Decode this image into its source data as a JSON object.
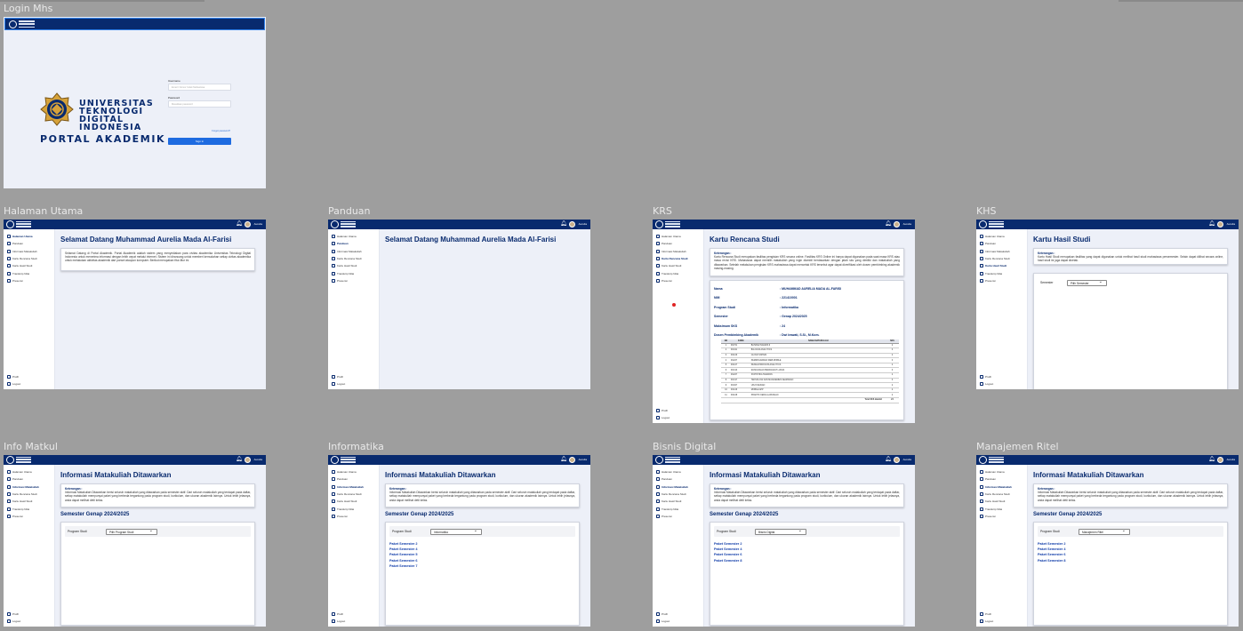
{
  "frames": {
    "login": "Login Mhs",
    "halaman_utama": "Halaman Utama",
    "panduan": "Panduan",
    "krs": "KRS",
    "khs": "KHS",
    "info_matkul": "Info Matkul",
    "informatika": "Informatika",
    "bisnis_digital": "Bisnis Digital",
    "manajemen_ritel": "Manajemen Ritel"
  },
  "colors": {
    "navy": "#082a6e",
    "accent_blue": "#1e6be0",
    "canvas": "#9e9e9e",
    "page_bg": "#edf0f8"
  },
  "login": {
    "uni_lines": [
      "UNIVERSITAS",
      "TEKNOLOGI",
      "DIGITAL",
      "INDONESIA"
    ],
    "portal": "PORTAL AKADEMIK",
    "username_label": "Username",
    "username_placeholder": "Email / Nomor Induk Mahasiswa",
    "password_label": "Password",
    "password_placeholder": "Masukkan password",
    "forgot": "Forgot password?",
    "signin": "Sign in"
  },
  "topbar": {
    "user": "Aurelia",
    "bell_icon": "bell-icon"
  },
  "nav": {
    "items": [
      "Halaman Utama",
      "Panduan",
      "Informasi Matakuliah",
      "Kartu Rencana Studi",
      "Kartu Hasil Studi",
      "Transkrip Nilai",
      "Presensi"
    ],
    "profil": "Profil",
    "logout": "Logout"
  },
  "home": {
    "welcome": "Selamat Datang Muhammad Aurelia Mada Al-Farisi",
    "text": "Selamat Datang di Portal Akademik. Portal Akademik adalah sistem yang menyediakan para civitas akademika Universitas Teknologi Digital Indonesia untuk menerima informasi dengan lebih cepat melalui internet. Sistem ini dirancang untuk memberi kemudahan setiap civitas akademika untuk melakukan aktivitas akademik dari ponsel ataupun komputer. Berikut merupakan fitur-fitur ini."
  },
  "krs": {
    "title": "Kartu Rencana Studi",
    "ket_title": "Keterangan :",
    "ket_text": "Kartu Rencana Studi merupakan fasilitas pengisian KRS secara online. Fasilitas KRS Online ini hanya dapat digunakan pada saat masa KRS atau masa revisi KRS. Mahasiswa dapat memilih matakuliah yang ingin diambil berdasarkan dengan jatah sks yang dimiliki dan matakuliah yang ditawarkan. Setelah melakukan pengisian KRS mahasiswa dapat mencetak KRS tersebut agar dapat diverifikasi oleh dosen pembimbing akademik masing-masing.",
    "labels": [
      "Nama",
      "NIM",
      "Program Studi",
      "Semester",
      "Maksimum SKS",
      "Dosen Pembimbing Akademik"
    ],
    "values": [
      ": MUHAMMAD AURELIA MADA AL-FARISI",
      ": 221410001",
      ": Informatika",
      ": Genap 2024/2025",
      ": 24",
      ": Dwi Irawati, S.Si., M.Kom."
    ],
    "table_head": [
      "NO",
      "KODE",
      "NAMA MATAKULIAH",
      "SKS"
    ],
    "rows": [
      [
        "1",
        "IF4701",
        "BAHASA INGGRIS II",
        "2"
      ],
      [
        "2",
        "IF4321",
        "BIG DATA ANALYTICS",
        "3"
      ],
      [
        "3",
        "IF4106",
        "CLOUD SISTEM",
        "2"
      ],
      [
        "4",
        "IF4207",
        "PEMROGRAMAN WEB MOBILE",
        "3"
      ],
      [
        "5",
        "IF4107",
        "PENGANTAR DATA ANALYTICS",
        "2"
      ],
      [
        "6",
        "IF4313",
        "RANCANGAN PERANGKAT LUNAK",
        "3"
      ],
      [
        "7",
        "IF4207",
        "STATISTIKA TERAPAN",
        "2"
      ],
      [
        "8",
        "IF4317",
        "TEKNOLOGI DAN MANAJEMEN KEAMANAN",
        "3"
      ],
      [
        "9",
        "IF4307",
        "UI/UX DESIGN",
        "2"
      ],
      [
        "10",
        "IF4106",
        "MOBILE APP",
        "2"
      ],
      [
        "11",
        "IF4108",
        "PRAKTIK KERJA LAPANGAN",
        "2"
      ]
    ],
    "total_label": "Total SKS diambil",
    "total": "24"
  },
  "khs": {
    "title": "Kartu Hasil Studi",
    "ket_title": "Keterangan :",
    "ket_text": "Kartu Hasil Studi merupakan fasilitas yang dapat digunakan untuk melihat hasil studi mahasiswa persemester. Selain dapat dilihat secara online, hasil studi ini juga dapat dicetak.",
    "sel_label": "Semester",
    "sel_value": "Pilih Semester"
  },
  "info": {
    "title": "Informasi Matakuliah Ditawarkan",
    "ket_title": "Keterangan :",
    "ket_text": "Informasi Matakuliah Ditawarkan berisi seluruh matakuliah yang ditawarkan pada semester aktif. Dari seluruh matakuliah yang terdapat pada daftar, setiap matakuliah mempunyai paket yang berbeda tergantung pada program studi, kurikulum, dan ukuran akademik lainnya. Untuk lebih jelasnya, anda dapat melihat detil kelas.",
    "semester": "Semester Genap 2024/2025",
    "prodi_label": "Program Studi",
    "prodi_default": "Pilih Program Studi",
    "prodi_if": "Informatika",
    "prodi_bd": "Bisnis Digital",
    "prodi_mr": "Manajemen Ritel",
    "paket_if": [
      "Paket Semester 2",
      "Paket Semester 4",
      "Paket Semester 5",
      "Paket Semester 6",
      "Paket Semester 7"
    ],
    "paket_other": [
      "Paket Semester 2",
      "Paket Semester 4",
      "Paket Semester 6",
      "Paket Semester 8"
    ]
  }
}
